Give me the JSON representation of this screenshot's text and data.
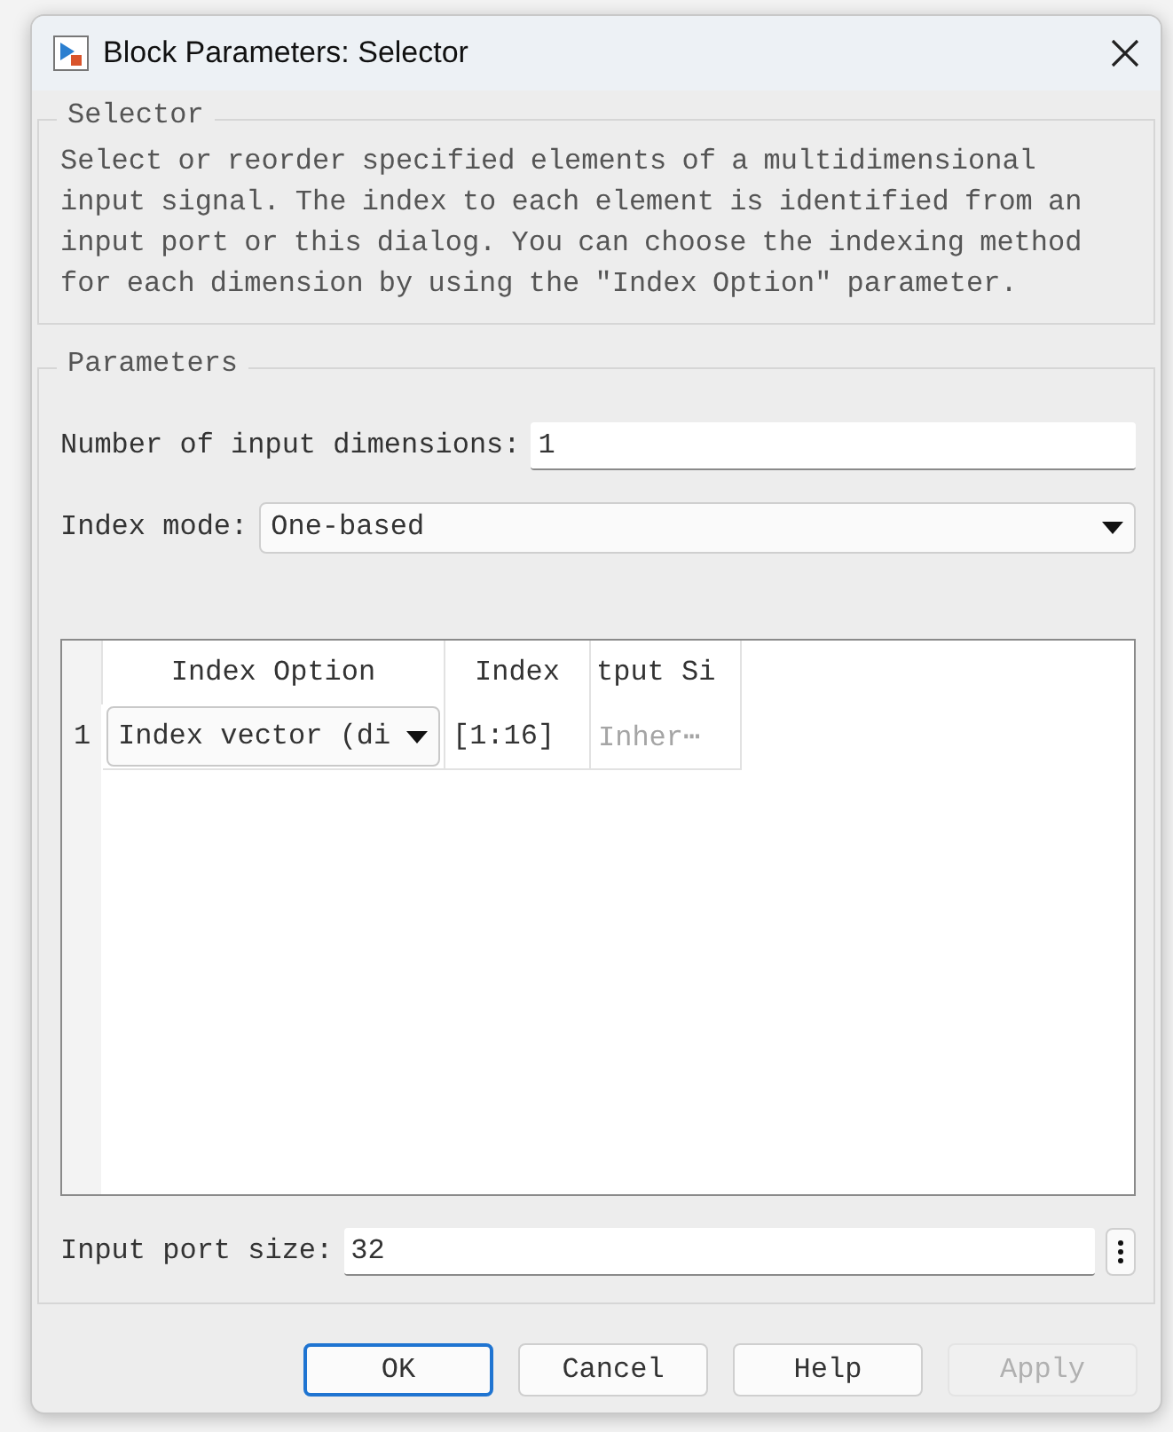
{
  "window": {
    "title": "Block Parameters: Selector"
  },
  "description_group": {
    "title": "Selector",
    "text": "Select or reorder specified elements of a multidimensional input signal. The index to each element is identified from an input port or this dialog. You can choose the indexing method for each dimension by using the \"Index Option\" parameter."
  },
  "parameters_group": {
    "title": "Parameters",
    "fields": [
      {
        "kind": "text",
        "label": "Number of input dimensions:",
        "value": "1"
      },
      {
        "kind": "dropdown",
        "label": "Index mode:",
        "value": "One-based"
      }
    ],
    "table": {
      "columns": [
        "Index Option",
        "Index",
        "tput Si"
      ],
      "rows": [
        {
          "number": "1",
          "cells": [
            {
              "kind": "dropdown",
              "text": "Index vector (di",
              "disabled": false
            },
            {
              "kind": "text",
              "text": "[1:16]",
              "disabled": false
            },
            {
              "kind": "text",
              "text": "Inher⋯",
              "disabled": true
            }
          ]
        }
      ]
    },
    "input_port_size": {
      "label": "Input port size:",
      "value": "32"
    }
  },
  "buttons": [
    {
      "label": "OK",
      "default": true,
      "disabled": false
    },
    {
      "label": "Cancel",
      "default": false,
      "disabled": false
    },
    {
      "label": "Help",
      "default": false,
      "disabled": false
    },
    {
      "label": "Apply",
      "default": false,
      "disabled": true
    }
  ]
}
